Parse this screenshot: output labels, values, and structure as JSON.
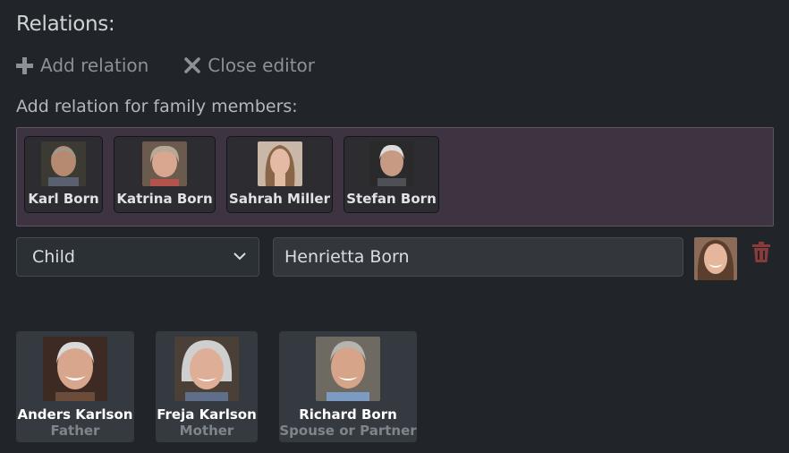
{
  "header": {
    "title": "Relations:"
  },
  "toolbar": {
    "add_label": "Add relation",
    "close_label": "Close editor"
  },
  "family_section": {
    "label": "Add relation for family members:",
    "members": [
      {
        "name": "Karl Born"
      },
      {
        "name": "Katrina Born"
      },
      {
        "name": "Sahrah Miller"
      },
      {
        "name": "Stefan Born"
      }
    ]
  },
  "new_relation": {
    "type_select": {
      "selected": "Child"
    },
    "person_input": {
      "value": "Henrietta Born"
    }
  },
  "relations": [
    {
      "name": "Anders Karlson",
      "relation": "Father"
    },
    {
      "name": "Freja Karlson",
      "relation": "Mother"
    },
    {
      "name": "Richard Born",
      "relation": "Spouse or Partner"
    }
  ],
  "colors": {
    "background": "#212529",
    "family_box": "#3e3340",
    "card": "#343a40",
    "trash": "#8b3a3a"
  }
}
